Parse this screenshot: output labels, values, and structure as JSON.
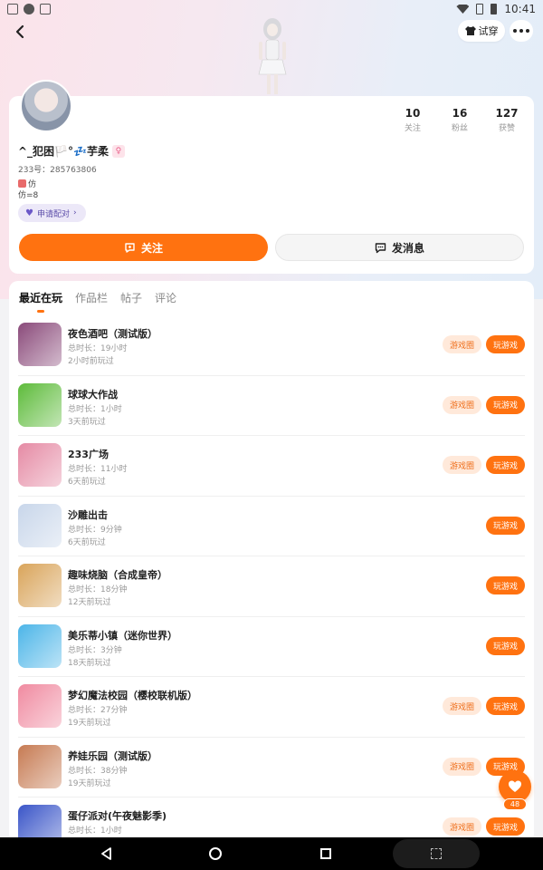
{
  "status_bar": {
    "time": "10:41"
  },
  "header": {
    "tryon_label": "试穿"
  },
  "profile": {
    "username": "^_犯困🏳️°💤芋柔",
    "gender_symbol": "♀",
    "uid": "233号：285763806",
    "bio_line1": "仿",
    "bio_line2": "仿=8",
    "pair_label": "申请配对",
    "stats": [
      {
        "value": "10",
        "label": "关注"
      },
      {
        "value": "16",
        "label": "粉丝"
      },
      {
        "value": "127",
        "label": "获赞"
      }
    ],
    "follow_label": "关注",
    "message_label": "发消息"
  },
  "tabs": [
    "最近在玩",
    "作品栏",
    "帖子",
    "评论"
  ],
  "games": [
    {
      "name": "夜色酒吧（测试版）",
      "duration": "总时长：19小时",
      "last_played": "2小时前玩过",
      "circle": "游戏圈",
      "play": "玩游戏",
      "icon_color": "#8a4a7a",
      "icon": "bar-game-icon"
    },
    {
      "name": "球球大作战",
      "duration": "总时长：1小时",
      "last_played": "3天前玩过",
      "circle": "游戏圈",
      "play": "玩游戏",
      "icon_color": "#5dbb3a",
      "icon": "ball-game-icon"
    },
    {
      "name": "233广场",
      "duration": "总时长：11小时",
      "last_played": "6天前玩过",
      "circle": "游戏圈",
      "play": "玩游戏",
      "icon_color": "#e58aa4",
      "icon": "plaza-game-icon"
    },
    {
      "name": "沙雕出击",
      "duration": "总时长：9分钟",
      "last_played": "6天前玩过",
      "circle": "",
      "play": "玩游戏",
      "icon_color": "#c8d6ea",
      "icon": "shadiao-game-icon"
    },
    {
      "name": "趣味烧脑（合成皇帝）",
      "duration": "总时长：18分钟",
      "last_played": "12天前玩过",
      "circle": "",
      "play": "玩游戏",
      "icon_color": "#d9a45a",
      "icon": "puzzle-game-icon"
    },
    {
      "name": "美乐蒂小镇（迷你世界）",
      "duration": "总时长：3分钟",
      "last_played": "18天前玩过",
      "circle": "",
      "play": "玩游戏",
      "icon_color": "#4cb5e8",
      "icon": "mini-world-game-icon"
    },
    {
      "name": "梦幻魔法校园（樱校联机版）",
      "duration": "总时长：27分钟",
      "last_played": "19天前玩过",
      "circle": "游戏圈",
      "play": "玩游戏",
      "icon_color": "#f08aa0",
      "icon": "magic-school-game-icon"
    },
    {
      "name": "养娃乐园（测试版）",
      "duration": "总时长：38分钟",
      "last_played": "19天前玩过",
      "circle": "游戏圈",
      "play": "玩游戏",
      "icon_color": "#c67a52",
      "icon": "baby-park-game-icon"
    },
    {
      "name": "蛋仔派对(午夜魅影季)",
      "duration": "总时长：1小时",
      "last_played": "",
      "circle": "游戏圈",
      "play": "玩游戏",
      "icon_color": "#3a55c8",
      "icon": "eggy-party-game-icon"
    }
  ],
  "like_fab": {
    "count": "48"
  }
}
